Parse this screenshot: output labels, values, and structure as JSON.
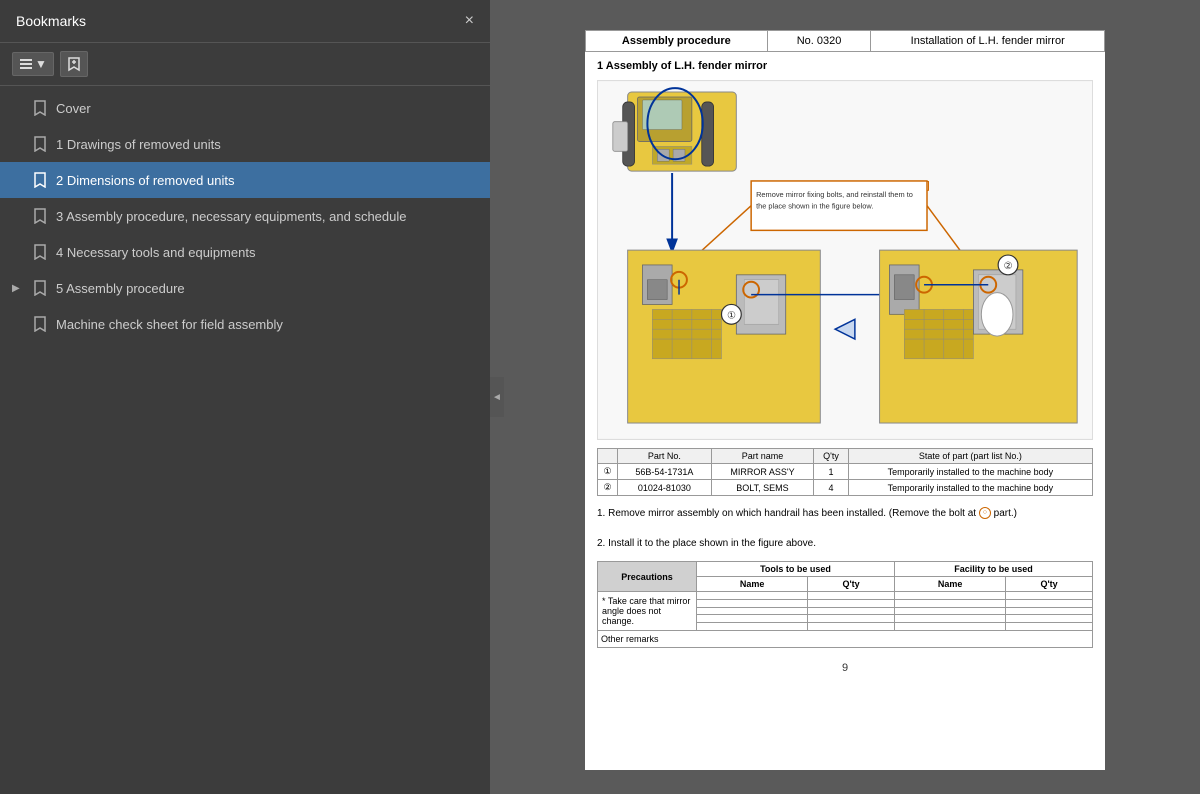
{
  "bookmarks": {
    "title": "Bookmarks",
    "close_label": "×",
    "toolbar": {
      "list_view_label": "≡",
      "bookmark_icon_label": "🔖"
    },
    "items": [
      {
        "id": "cover",
        "label": "Cover",
        "level": 0,
        "active": false,
        "expandable": false
      },
      {
        "id": "drawings",
        "label": "1 Drawings of removed units",
        "level": 0,
        "active": false,
        "expandable": false
      },
      {
        "id": "dimensions",
        "label": "2 Dimensions of removed units",
        "level": 0,
        "active": true,
        "expandable": false
      },
      {
        "id": "assembly-procedure",
        "label": "3 Assembly procedure, necessary equipments, and schedule",
        "level": 0,
        "active": false,
        "expandable": false
      },
      {
        "id": "necessary-tools",
        "label": "4 Necessary tools and equipments",
        "level": 0,
        "active": false,
        "expandable": false
      },
      {
        "id": "assembly",
        "label": "5 Assembly procedure",
        "level": 0,
        "active": false,
        "expandable": true
      },
      {
        "id": "machine-check",
        "label": "Machine check sheet for field assembly",
        "level": 0,
        "active": false,
        "expandable": false
      }
    ]
  },
  "document": {
    "header": {
      "col1": "Assembly procedure",
      "col2": "No. 0320",
      "col3": "Installation of L.H. fender mirror"
    },
    "section_title": "1 Assembly of L.H. fender mirror",
    "annotation_text": "Remove mirror fixing bolts, and reinstall them to the place shown in the figure below.",
    "parts_table": {
      "headers": [
        "",
        "Part No.",
        "Part name",
        "Q'ty",
        "State of part (part list No.)"
      ],
      "rows": [
        {
          "num": "①",
          "part_no": "56B-54-1731A",
          "part_name": "MIRROR ASS'Y",
          "qty": "1",
          "state": "Temporarily installed to the machine body"
        },
        {
          "num": "②",
          "part_no": "01024-81030",
          "part_name": "BOLT, SEMS",
          "qty": "4",
          "state": "Temporarily installed to the machine body"
        }
      ]
    },
    "instructions": [
      "1. Remove mirror assembly on which handrail has been installed. (Remove the bolt at ○ part.)",
      "2. Install it to the place shown in the figure above."
    ],
    "bottom_table": {
      "precautions_label": "Precautions",
      "tools_label": "Tools to be used",
      "facility_label": "Facility to be used",
      "precaution_text": "* Take care that mirror angle does not change.",
      "name_label": "Name",
      "qty_label": "Q'ty",
      "other_remarks": "Other remarks"
    },
    "page_number": "9"
  },
  "collapse_icon": "◄"
}
